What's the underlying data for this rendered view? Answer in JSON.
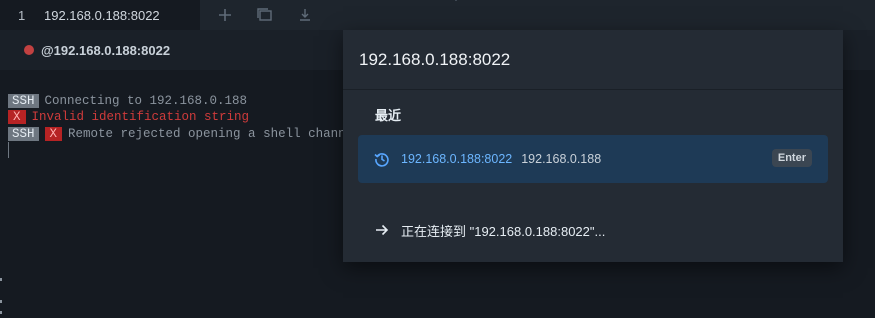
{
  "tab": {
    "index": "1",
    "title": "192.168.0.188:8022"
  },
  "tab_tools": [
    "plus-icon",
    "duplicate-icon",
    "download-icon"
  ],
  "session": {
    "status_color": "#c24141",
    "host_label": "@192.168.0.188:8022"
  },
  "terminal": {
    "line1": {
      "badge": "SSH",
      "text": "Connecting to 192.168.0.188"
    },
    "line2": {
      "badge": "X",
      "text": "Invalid identification string"
    },
    "line3": {
      "badge1": "SSH",
      "badge2": "X",
      "text": "Remote rejected opening a shell channe"
    }
  },
  "palette": {
    "query": "192.168.0.188:8022",
    "section_title": "最近",
    "recent": {
      "primary": "192.168.0.188:8022",
      "secondary": "192.168.0.188",
      "hint": "Enter",
      "icon": "history-icon"
    },
    "status": "正在连接到 \"192.168.0.188:8022\"..."
  },
  "colors": {
    "background": "#151a21",
    "accent": "#58a6ff",
    "selected_item": "#1e3a56",
    "error": "#cf3b3b"
  }
}
